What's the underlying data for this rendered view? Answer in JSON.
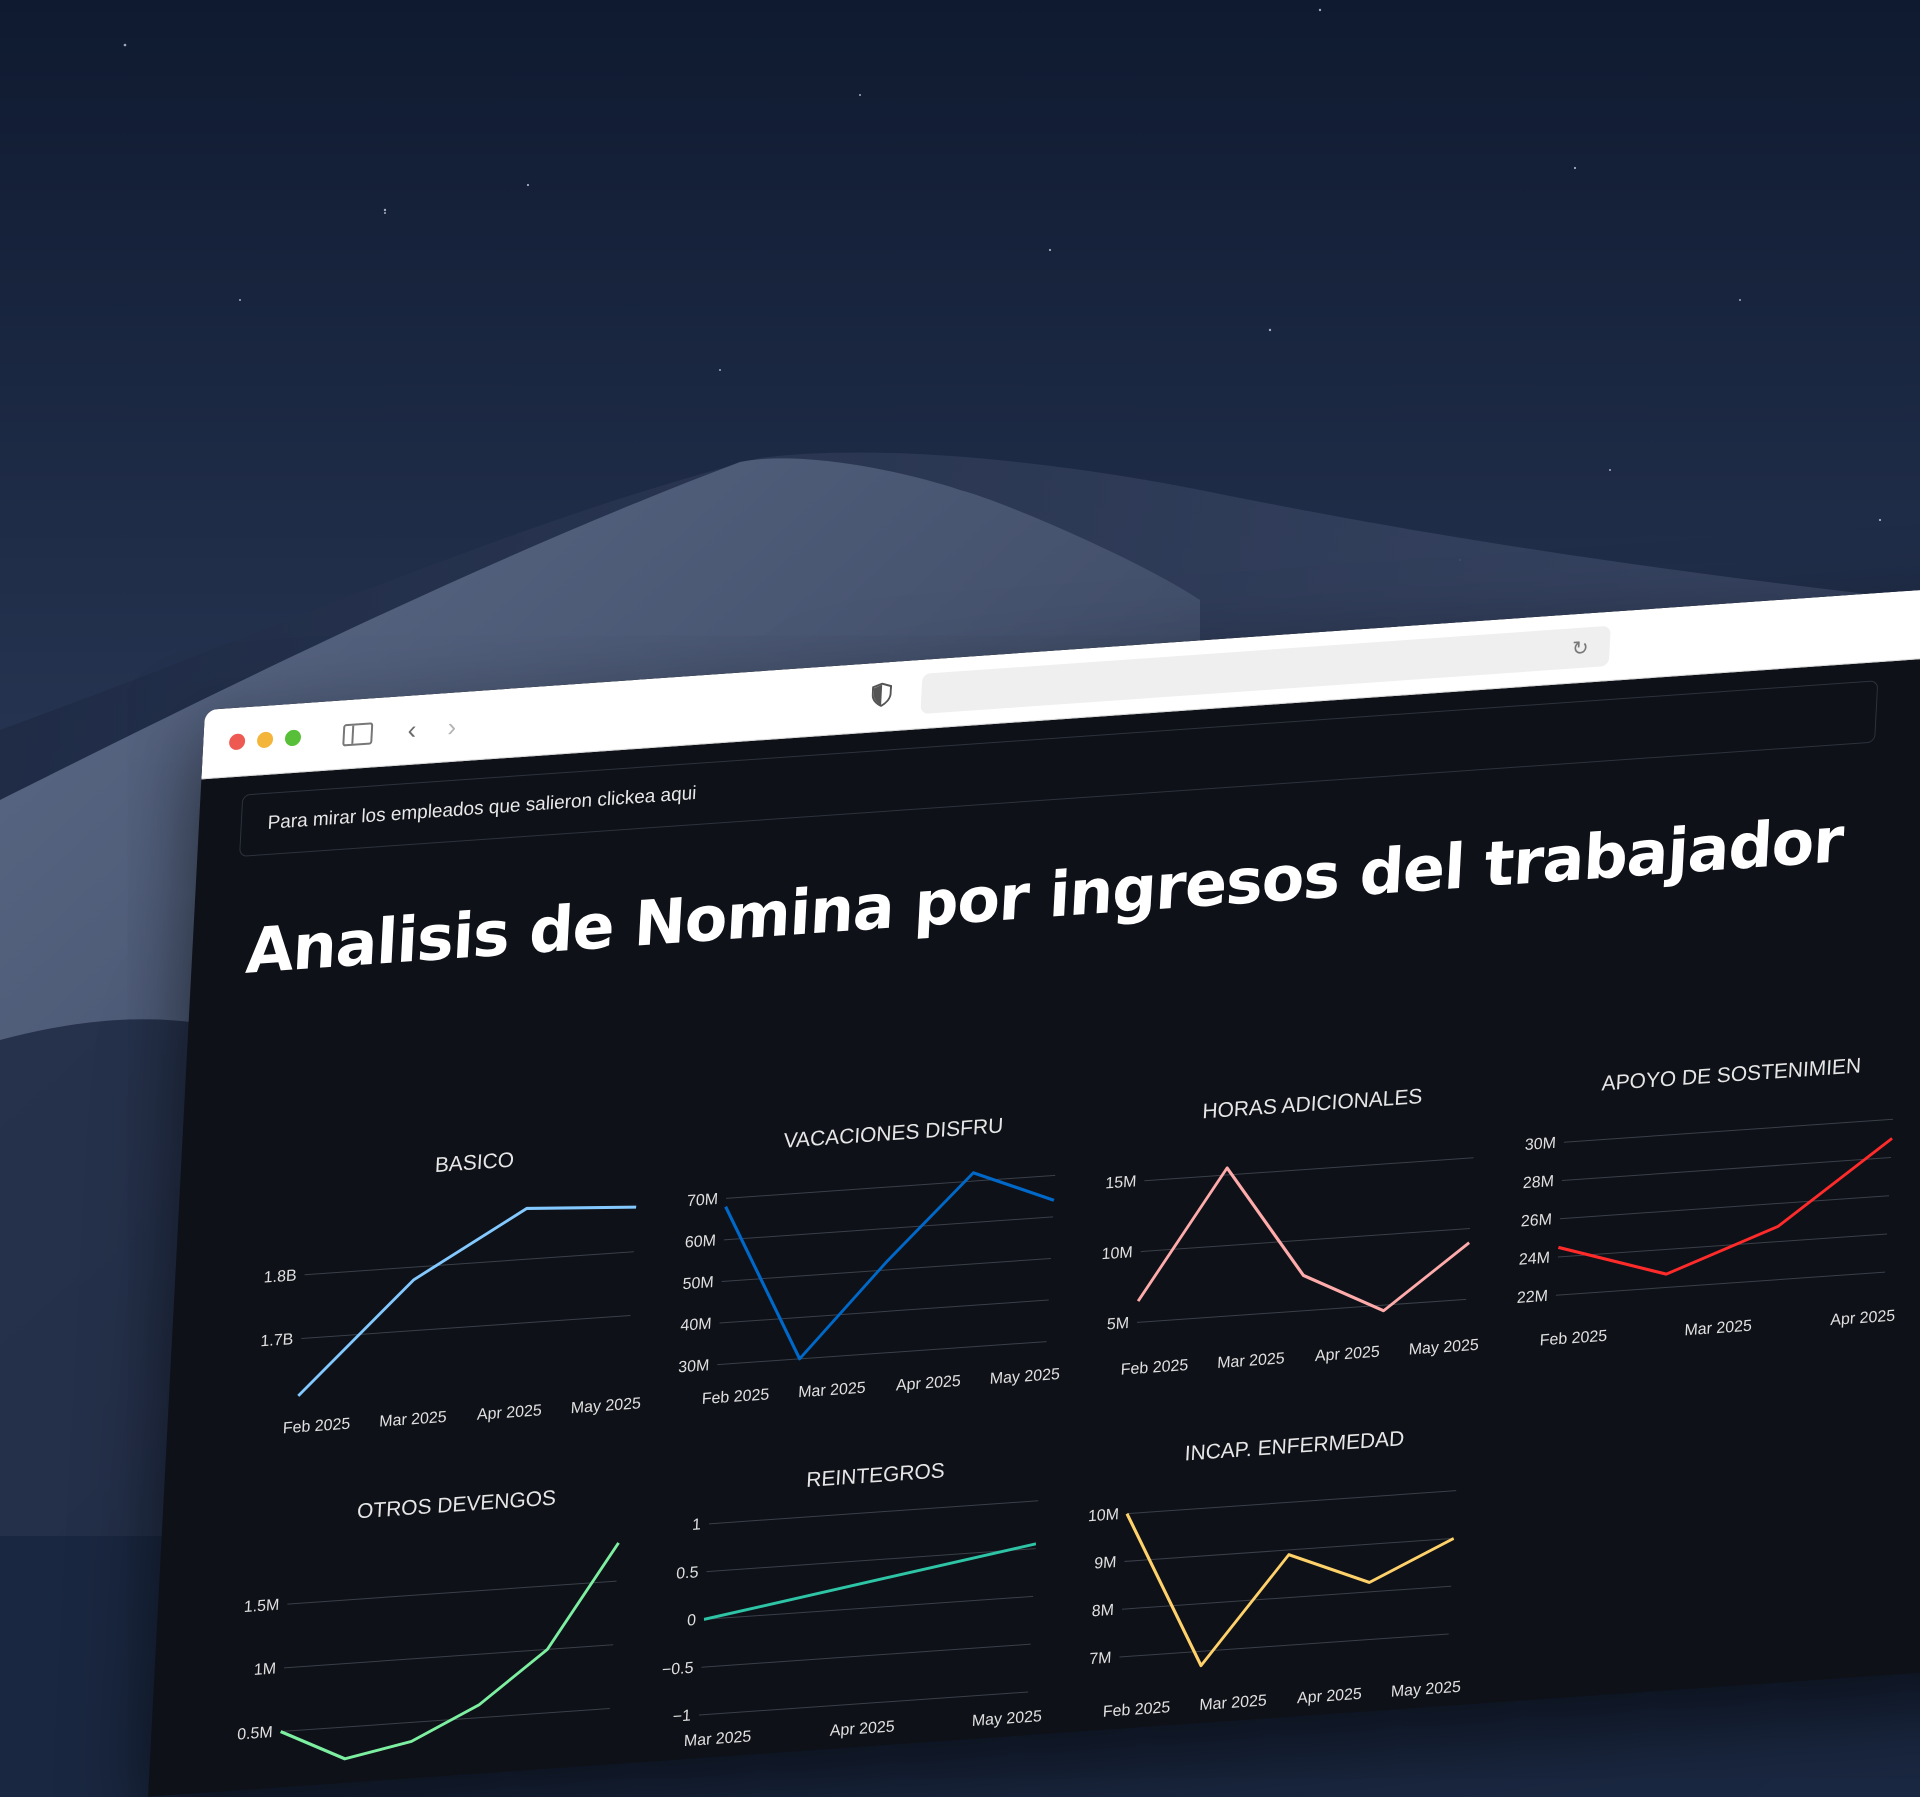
{
  "browser": {
    "url": "",
    "expander_label": "Para mirar los empleados que salieron clickea aqui"
  },
  "page": {
    "title": "Analisis de Nomina por ingresos del trabajador"
  },
  "chart_data": [
    {
      "type": "line",
      "title": "BASICO",
      "color": "#83c9ff",
      "x": [
        "Feb 2025",
        "Mar 2025",
        "Apr 2025",
        "May 2025"
      ],
      "values": [
        1610000000,
        1780000000,
        1880000000,
        1870000000
      ],
      "ylim": [
        1600000000,
        1900000000
      ],
      "yticks": [
        1700000000,
        1800000000
      ],
      "ytick_labels": [
        "1.7B",
        "1.8B"
      ]
    },
    {
      "type": "line",
      "title": "VACACIONES DISFRU",
      "color": "#0068c9",
      "x": [
        "Feb 2025",
        "Mar 2025",
        "Apr 2025",
        "May 2025"
      ],
      "values": [
        68000000,
        30000000,
        52000000,
        72000000,
        64000000
      ],
      "ylim": [
        28000000,
        74000000
      ],
      "yticks": [
        30000000,
        40000000,
        50000000,
        60000000,
        70000000
      ],
      "ytick_labels": [
        "30M",
        "40M",
        "50M",
        "60M",
        "70M"
      ]
    },
    {
      "type": "line",
      "title": "HORAS ADICIONALES",
      "color": "#ffabab",
      "x": [
        "Feb 2025",
        "Mar 2025",
        "Apr 2025",
        "May 2025"
      ],
      "values": [
        6500000,
        15500000,
        7500000,
        4600000,
        9000000
      ],
      "ylim": [
        3500000,
        17000000
      ],
      "yticks": [
        5000000,
        10000000,
        15000000
      ],
      "ytick_labels": [
        "5M",
        "10M",
        "15M"
      ]
    },
    {
      "type": "line",
      "title": "APOYO DE SOSTENIMIEN",
      "color": "#ff2b2b",
      "x": [
        "Feb 2025",
        "Mar 2025",
        "Apr 2025"
      ],
      "values": [
        24500000,
        22700000,
        24800000,
        29000000
      ],
      "ylim": [
        21000000,
        31000000
      ],
      "yticks": [
        22000000,
        24000000,
        26000000,
        28000000,
        30000000
      ],
      "ytick_labels": [
        "22M",
        "24M",
        "26M",
        "28M",
        "30M"
      ]
    },
    {
      "type": "line",
      "title": "OTROS DEVENGOS",
      "color": "#7defa1",
      "x": [],
      "values": [
        500000,
        250000,
        350000,
        600000,
        1000000,
        1800000
      ],
      "ylim": [
        400000,
        1900000
      ],
      "yticks": [
        500000,
        1000000,
        1500000
      ],
      "ytick_labels": [
        "0.5M",
        "1M",
        "1.5M"
      ]
    },
    {
      "type": "line",
      "title": "REINTEGROS",
      "color": "#2ec4a6",
      "x": [
        "Mar 2025",
        "Apr 2025",
        "May 2025"
      ],
      "values": [
        0,
        0.55
      ],
      "ylim": [
        -1,
        1
      ],
      "yticks": [
        -1,
        -0.5,
        0,
        0.5,
        1
      ],
      "ytick_labels": [
        "−1",
        "−0.5",
        "0",
        "0.5",
        "1"
      ]
    },
    {
      "type": "line",
      "title": "INCAP. ENFERMEDAD",
      "color": "#ffd16a",
      "x": [
        "Feb 2025",
        "Mar 2025",
        "Apr 2025",
        "May 2025"
      ],
      "values": [
        10000000,
        6700000,
        8900000,
        8200000,
        9000000
      ],
      "ylim": [
        6400000,
        10400000
      ],
      "yticks": [
        7000000,
        8000000,
        9000000,
        10000000
      ],
      "ytick_labels": [
        "7M",
        "8M",
        "9M",
        "10M"
      ]
    }
  ]
}
